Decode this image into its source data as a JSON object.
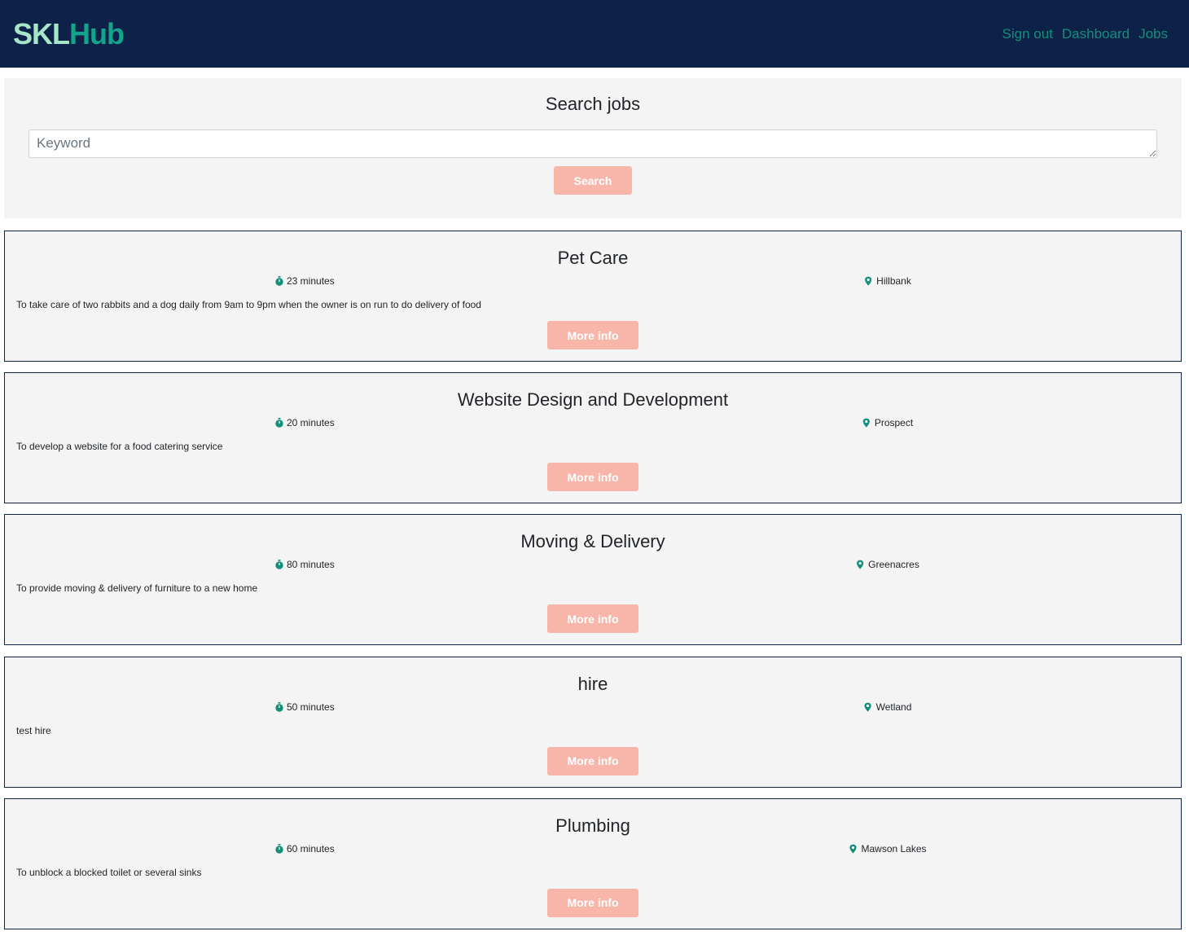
{
  "navbar": {
    "logo_part1": "SKL",
    "logo_part2": "Hub",
    "links": [
      "Sign out",
      "Dashboard",
      "Jobs"
    ]
  },
  "search": {
    "title": "Search jobs",
    "placeholder": "Keyword",
    "value": "",
    "button_label": "Search"
  },
  "jobs": [
    {
      "title": "Pet Care",
      "duration": "23 minutes",
      "location": "Hillbank",
      "description": "To take care of two rabbits and a dog daily from 9am to 9pm when the owner is on run to do delivery of food",
      "button_label": "More info"
    },
    {
      "title": "Website Design and Development",
      "duration": "20 minutes",
      "location": "Prospect",
      "description": "To develop a website for a food catering service",
      "button_label": "More info"
    },
    {
      "title": "Moving & Delivery",
      "duration": "80 minutes",
      "location": "Greenacres",
      "description": "To provide moving & delivery of furniture to a new home",
      "button_label": "More info"
    },
    {
      "title": "hire",
      "duration": "50 minutes",
      "location": "Wetland",
      "description": "test hire",
      "button_label": "More info"
    },
    {
      "title": "Plumbing",
      "duration": "60 minutes",
      "location": "Mawson Lakes",
      "description": "To unblock a blocked toilet or several sinks",
      "button_label": "More info"
    }
  ],
  "icons": {
    "duration": "stopwatch-icon",
    "location": "map-pin-icon"
  },
  "colors": {
    "navbar_bg": "#0e2148",
    "accent": "#13a58c",
    "button": "#f8b5aa",
    "panel_bg": "#f4f4f4"
  }
}
